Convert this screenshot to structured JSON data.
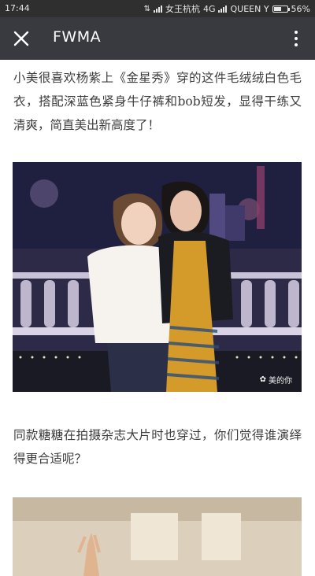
{
  "status": {
    "time": "17:44",
    "carrier1": "女王杭杭",
    "net": "4G",
    "carrier2": "QUEEN Y",
    "battery_text": "56%",
    "battery_level": 0.56
  },
  "header": {
    "title": "FWMA",
    "bg": "#393a3f",
    "close_icon": "close-icon",
    "more_icon": "more-vertical-icon"
  },
  "article": {
    "paragraph1": "小美很喜欢杨紫上《金星秀》穿的这件毛绒绒白色毛衣，搭配深蓝色紧身牛仔裤和bob短发，显得干练又清爽，简直美出新高度了！",
    "paragraph2": "同款糖糖在拍摄杂志大片时也穿过，你们觉得谁演绎得更合适呢？",
    "watermark": "美的你"
  }
}
